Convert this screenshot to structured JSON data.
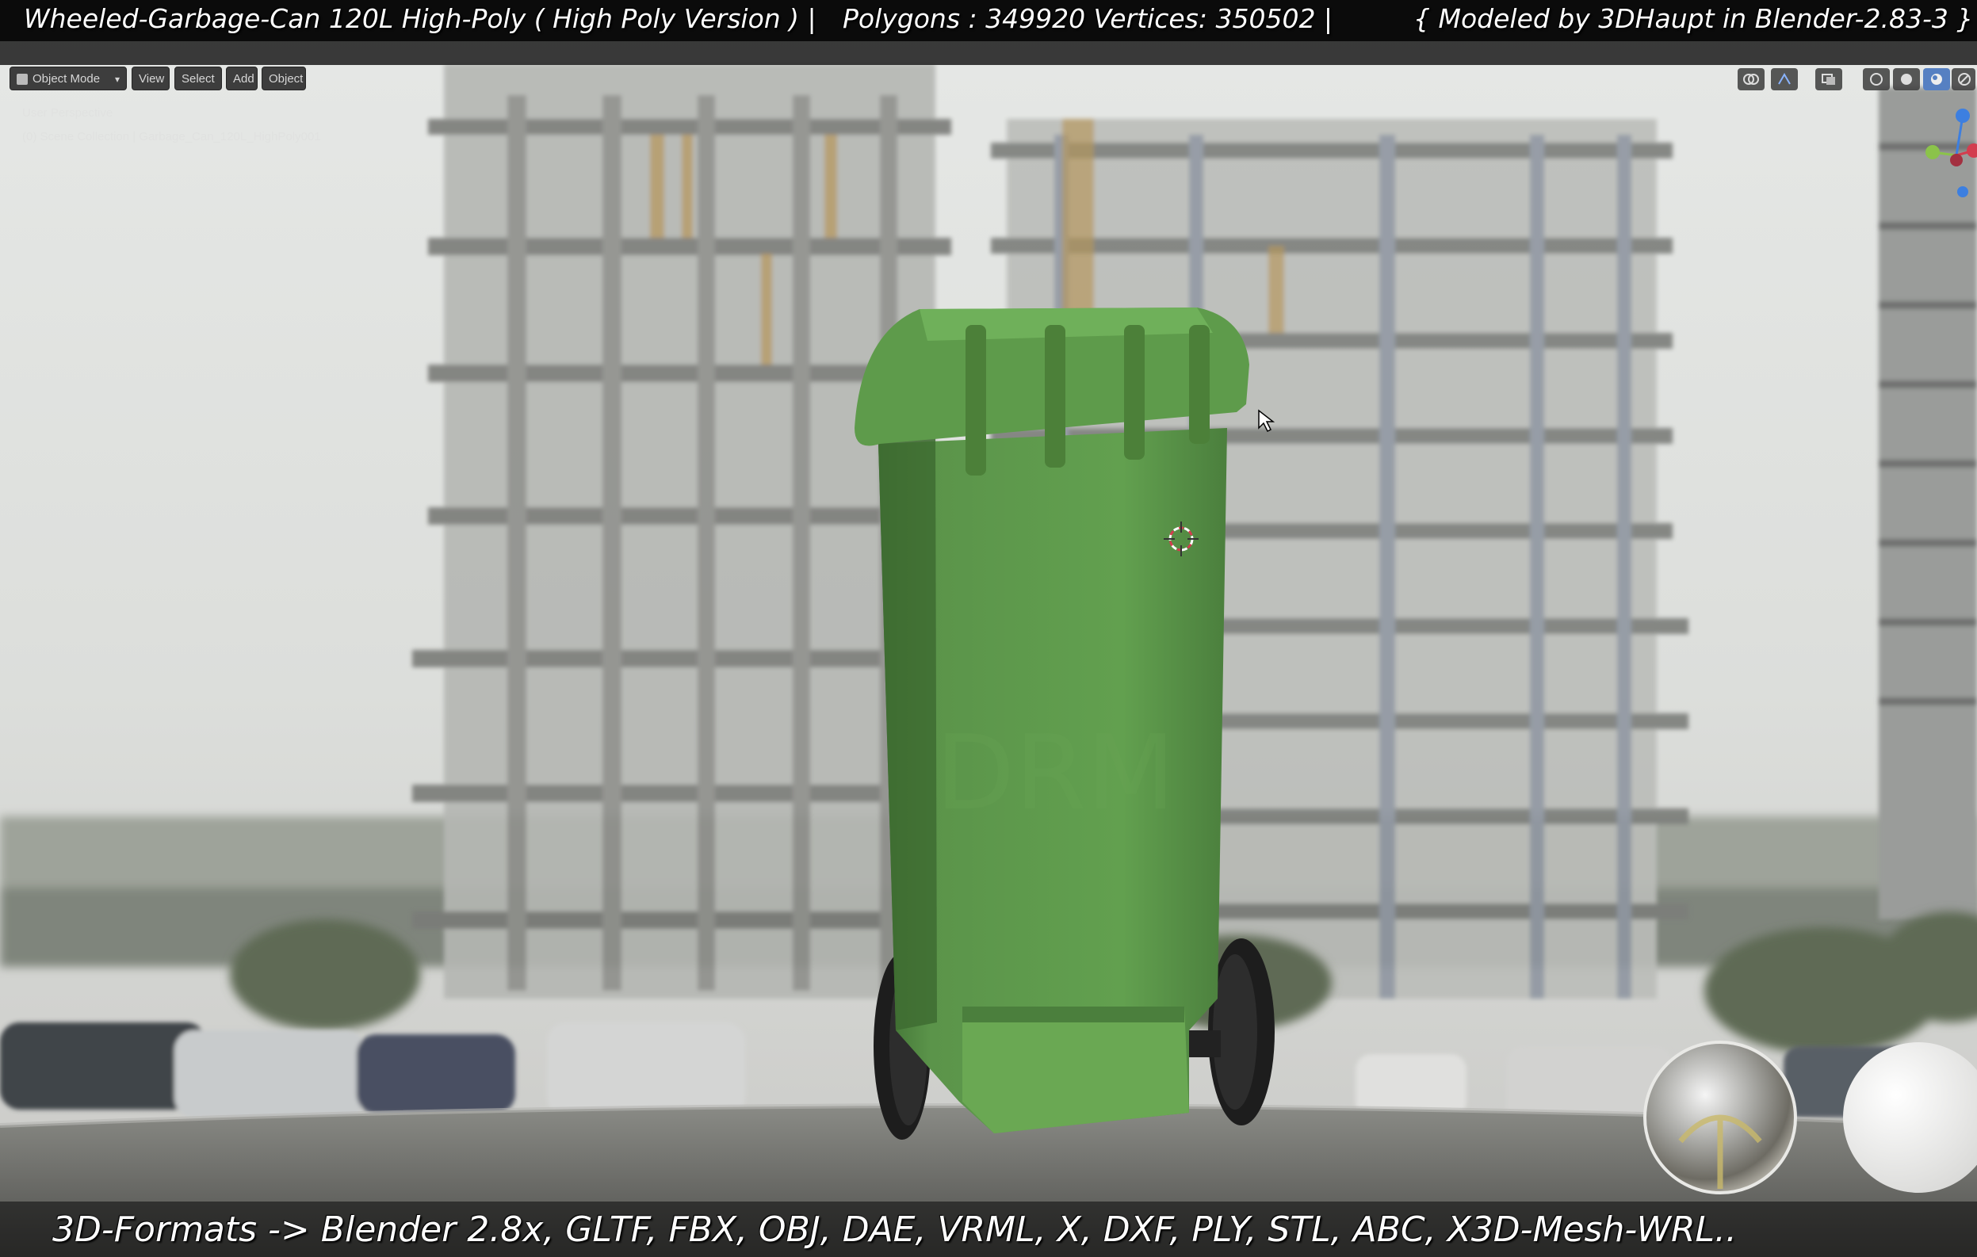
{
  "captions": {
    "title": "Wheeled-Garbage-Can 120L High-Poly ( High Poly Version )  |",
    "poly": "Polygons : 349920  Vertices: 350502     |",
    "model": "{ Modeled by 3DHaupt in Blender-2.83-3 }",
    "formats": "3D-Formats -> Blender 2.8x, GLTF, FBX, OBJ, DAE, VRML, X, DXF, PLY, STL, ABC, X3D-Mesh-WRL.."
  },
  "header": {
    "mode_label": "Object Mode",
    "menu": {
      "view": "View",
      "select": "Select",
      "add": "Add",
      "object": "Object"
    }
  },
  "viewport": {
    "perspective_label": "User Perspective",
    "collection_label": "(0) Scene Collection | Garbage_Can_120L_HighPoly001"
  },
  "icons": [
    "overlay-icon",
    "gizmo-icon",
    "xray-icon",
    "wireframe-icon",
    "solid-icon",
    "material-icon",
    "rendered-icon",
    "mouse-cursor-icon",
    "3d-cursor-icon"
  ],
  "colors": {
    "bin_green": "#5e9a4a",
    "accent_blue": "#5680c2",
    "axis_x": "#d33d4f",
    "axis_y": "#8bc34a",
    "axis_z": "#3d7fe0"
  }
}
